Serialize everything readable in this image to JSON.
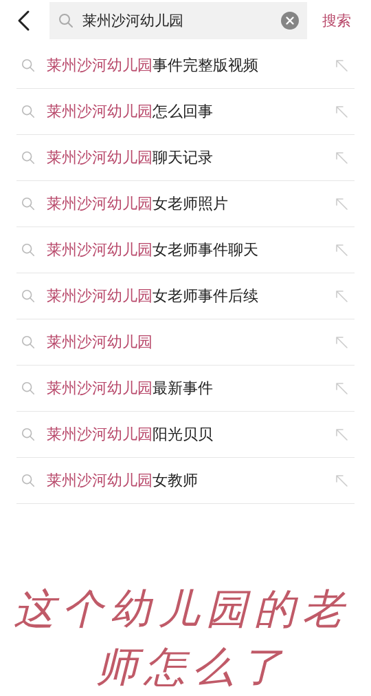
{
  "search": {
    "value": "莱州沙河幼儿园",
    "button": "搜索"
  },
  "suggestions": [
    {
      "match": "莱州沙河幼儿园",
      "rest": "事件完整版视频"
    },
    {
      "match": "莱州沙河幼儿园",
      "rest": "怎么回事"
    },
    {
      "match": "莱州沙河幼儿园",
      "rest": "聊天记录"
    },
    {
      "match": "莱州沙河幼儿园",
      "rest": "女老师照片"
    },
    {
      "match": "莱州沙河幼儿园",
      "rest": "女老师事件聊天"
    },
    {
      "match": "莱州沙河幼儿园",
      "rest": "女老师事件后续"
    },
    {
      "match": "莱州沙河幼儿园"
    },
    {
      "match": "莱州沙河幼儿园",
      "rest": "最新事件"
    },
    {
      "match": "莱州沙河幼儿园",
      "rest": "阳光贝贝"
    },
    {
      "match": "莱州沙河幼儿园",
      "rest": "女教师"
    }
  ],
  "handwritten_note": "这个幼儿园的老师怎么了"
}
